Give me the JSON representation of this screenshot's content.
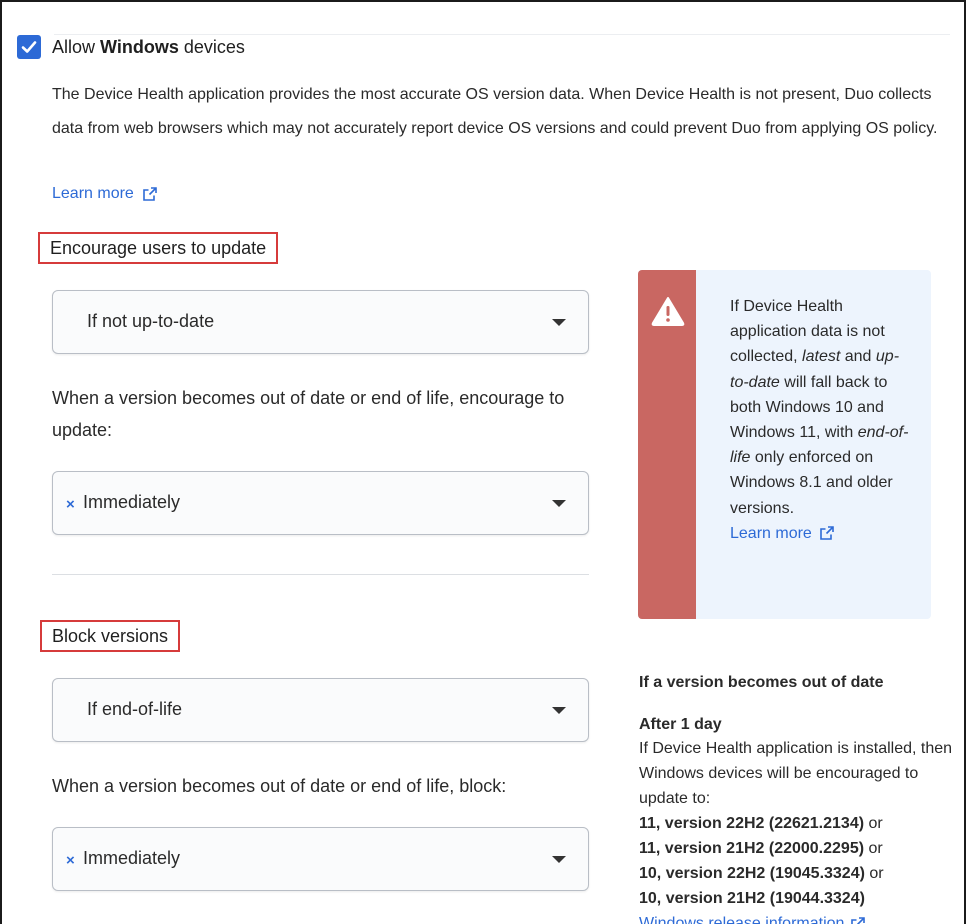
{
  "allow": {
    "prefix": "Allow ",
    "bold": "Windows",
    "suffix": " devices",
    "checked": true
  },
  "description": "The Device Health application provides the most accurate OS version data. When Device Health is not present, Duo collects data from web browsers which may not accurately report device OS versions and could prevent Duo from applying OS policy.",
  "learn_more_top": "Learn more",
  "encourage": {
    "title": "Encourage users to update",
    "select_value": "If not up-to-date",
    "prompt": "When a version becomes out of date or end of life, encourage to update:",
    "timing_value": "Immediately",
    "timing_remove": "×"
  },
  "block": {
    "title": "Block versions",
    "select_value": "If end-of-life",
    "prompt": "When a version becomes out of date or end of life, block:",
    "timing_value": "Immediately",
    "timing_remove": "×"
  },
  "callout": {
    "t1": "If Device Health application data is not collected, ",
    "t2": "latest",
    "t3": " and ",
    "t4": "up-to-date",
    "t5": " will fall back to both Windows 10 and Windows 11, with ",
    "t6": "end-of-life",
    "t7": " only enforced on Windows 8.1 and older versions.",
    "learn_more": "Learn more",
    "bar_color": "#c96762",
    "bg_color": "#edf4fd"
  },
  "info": {
    "heading": "If a version becomes out of date",
    "sub": "After 1 day",
    "body": "If Device Health application is installed, then Windows devices will be encouraged to update to:",
    "versions": [
      {
        "name": "11, version 22H2 (22621.2134)",
        "suffix": " or"
      },
      {
        "name": "11, version 21H2 (22000.2295)",
        "suffix": " or"
      },
      {
        "name": "10, version 22H2 (19045.3324)",
        "suffix": " or"
      },
      {
        "name": "10, version 21H2 (19044.3324)",
        "suffix": ""
      }
    ],
    "release_link": "Windows release information"
  },
  "colors": {
    "accent": "#2d6ad6",
    "highlight_border": "#d63b3b"
  }
}
